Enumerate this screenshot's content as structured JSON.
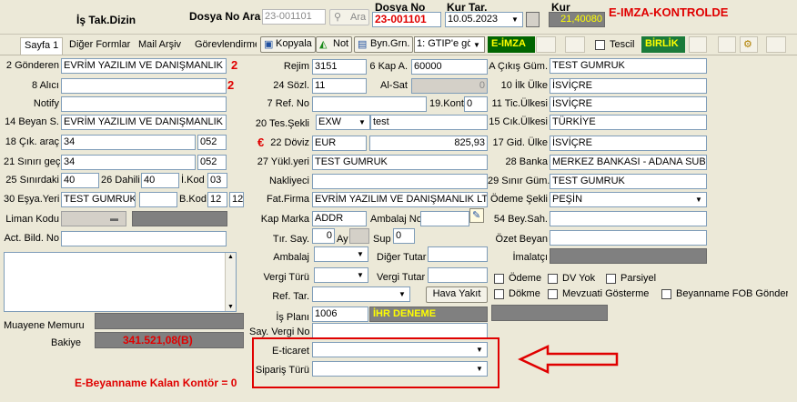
{
  "header": {
    "is_tak_label": "İş Tak.Dizin",
    "dosya_no_ara_label": "Dosya No Ara",
    "dosya_no_ara_value": "23-001101",
    "ara_button": "Ara",
    "dosya_no_label": "Dosya No",
    "dosya_no_value": "23-001101",
    "kur_tar_label": "Kur Tar.",
    "kur_tar_value": "10.05.2023",
    "kur_label": "Kur",
    "kur_value": "21,40080",
    "e_imza_status": "E-IMZA-KONTROLDE"
  },
  "tabs": [
    {
      "label": "Sayfa 1"
    },
    {
      "label": "Diğer Formlar"
    },
    {
      "label": "Mail Arşiv"
    },
    {
      "label": "Görevlendirme"
    }
  ],
  "toolbar": {
    "kopyala": "Kopyala",
    "not": "Not",
    "byn_grn": "Byn.Grn.",
    "gtip_select": "1: GTIP'e gö",
    "e_imza_badge": "E-İMZA",
    "tescil_label": "Tescil",
    "birlik_badge": "BİRLİK"
  },
  "left": {
    "gonderen_label": "2 Gönderen",
    "gonderen_value": "EVRİM YAZILIM VE DANIŞMANLIK L",
    "gonderen_marker": "2",
    "alici_label": "8 Alıcı",
    "alici_value": "",
    "alici_marker": "2",
    "notify_label": "Notify",
    "notify_value": "",
    "beyan_label": "14 Beyan S.",
    "beyan_value": "EVRİM YAZILIM VE DANIŞMANLIK",
    "cik_arac_label": "18 Çık. araç",
    "cik_arac_value": "34",
    "cik_arac_code": "052",
    "sinir_gec_label": "21 Sınırı geç.",
    "sinir_gec_value": "34",
    "sinir_gec_code": "052",
    "sinirdaki_label": "25 Sınırdaki",
    "sinirdaki_value": "40",
    "dahili_label": "26 Dahili",
    "dahili_value": "40",
    "i_kod_label": "İ.Kod",
    "i_kod_value": "03",
    "esya_yeri_label": "30 Eşya.Yeri",
    "esya_yeri_value": "TEST GUMRUK",
    "b_kod_label": "B.Kod",
    "b_kod_value": "12",
    "b_kod_value2": "12",
    "liman_kodu_label": "Liman Kodu",
    "act_bild_label": "Act. Bild. No",
    "act_bild_value": "",
    "muayene_label": "Muayene Memuru",
    "bakiye_label": "Bakiye",
    "bakiye_value": "341.521,08(B)",
    "kontor_text": "E-Beyanname Kalan Kontör = 0"
  },
  "middle": {
    "rejim_label": "Rejim",
    "rejim_value": "3151",
    "kap_a_label": "6 Kap A.",
    "kap_a_value": "60000",
    "sozl_label": "24 Sözl.",
    "sozl_value": "11",
    "al_sat_label": "Al-Sat",
    "al_sat_value": "0",
    "ref_no_label": "7 Ref. No",
    "ref_no_value": "",
    "kont_label": "19.Kont.",
    "kont_value": "0",
    "tes_sekli_label": "20 Tes.Şekli",
    "tes_sekli_value": "EXW",
    "tes_sekli_text": "test",
    "doviz_marker": "€",
    "doviz_label": "22 Döviz",
    "doviz_value": "EUR",
    "doviz_amount": "825,93",
    "yuk_yeri_label": "27 Yükl.yeri",
    "yuk_yeri_value": "TEST GUMRUK",
    "nakliyeci_label": "Nakliyeci",
    "nakliyeci_value": "",
    "fat_firma_label": "Fat.Firma",
    "fat_firma_value": "EVRİM YAZILIM VE DANIŞMANLIK LT",
    "kap_marka_label": "Kap Marka",
    "kap_marka_value": "ADDR",
    "ambalaj_no_label": "Ambalaj No",
    "tir_say_label": "Tır. Say.",
    "tir_say_value": "0",
    "ay_label": "Ay",
    "sup_label": "Sup",
    "sup_value": "0",
    "ambalaj_label": "Ambalaj",
    "diger_tutar_label": "Diğer Tutar",
    "vergi_turu_label": "Vergi Türü",
    "vergi_tutar_label": "Vergi Tutar",
    "ref_tar_label": "Ref. Tar.",
    "hava_yakit_button": "Hava Yakıt",
    "is_plani_label": "İş Planı",
    "is_plani_value": "1006",
    "is_plani_badge": "İHR DENEME",
    "say_vergi_label": "Say. Vergi No",
    "e_ticaret_label": "E-ticaret",
    "siparis_turu_label": "Sipariş Türü"
  },
  "right": {
    "a_cikis_label": "A Çıkış Güm.",
    "a_cikis_value": "TEST GUMRUK",
    "ilk_ulke_label": "10 İlk Ülke",
    "ilk_ulke_value": "İSVİÇRE",
    "tic_ulkesi_label": "11 Tic.Ülkesi",
    "tic_ulkesi_value": "İSVİÇRE",
    "cik_ulkesi_label": "15 Cık.Ülkesi",
    "cik_ulkesi_value": "TÜRKİYE",
    "gid_ulke_label": "17 Gid. Ülke",
    "gid_ulke_value": "İSVİÇRE",
    "banka_label": "28 Banka",
    "banka_value": "MERKEZ BANKASI - ADANA SUBES",
    "sinir_gum_label": "29 Sınır Güm.",
    "sinir_gum_value": "TEST GUMRUK",
    "odeme_sekli_label": "Ödeme Şekli",
    "odeme_sekli_value": "PEŞİN",
    "bey_sah_label": "54 Bey.Sah.",
    "ozet_beyan_label": "Özet Beyan",
    "imalatci_label": "İmalatçı",
    "odeme_chk": "Ödeme",
    "dv_yok_chk": "DV Yok",
    "parsiyel_chk": "Parsiyel",
    "dokme_chk": "Dökme",
    "mevzuati_chk": "Mevzuati Gösterme",
    "fob_chk": "Beyanname FOB Gönder"
  },
  "colors": {
    "highlight_red": "#e00000",
    "badge_green_bg": "#006400",
    "badge_yellow": "#ffff00",
    "gray_field": "#808080"
  }
}
